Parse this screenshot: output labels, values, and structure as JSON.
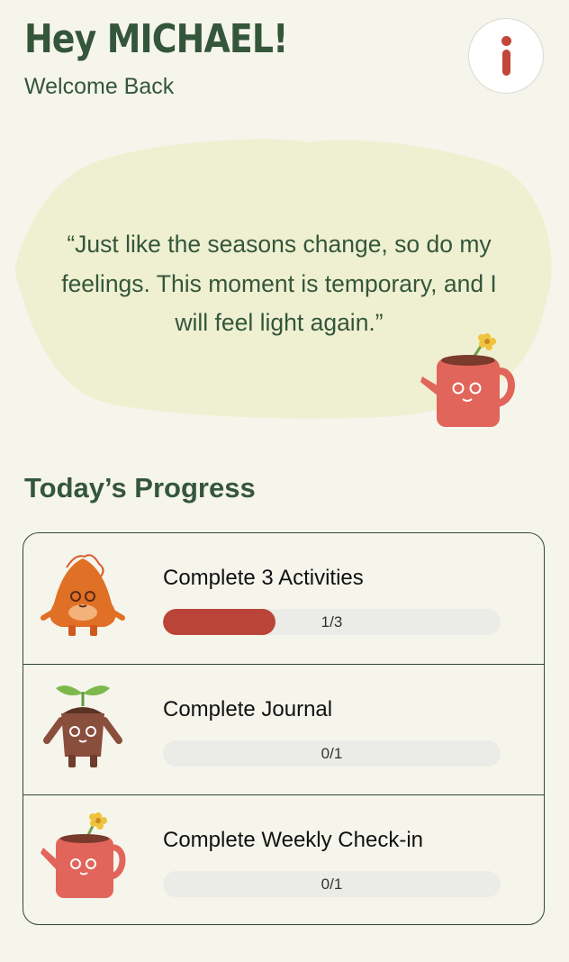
{
  "header": {
    "greeting": "Hey MICHAEL!",
    "subtitle": "Welcome Back",
    "info_icon": "info-icon"
  },
  "quote": {
    "text": "“Just like the seasons change, so do my feelings. This moment is temporary, and I will feel light again.”"
  },
  "progress": {
    "title": "Today’s Progress",
    "items": [
      {
        "label": "Complete 3 Activities",
        "count_text": "1/3",
        "completed": 1,
        "total": 3,
        "icon": "orange-flame-mascot-icon"
      },
      {
        "label": "Complete Journal",
        "count_text": "0/1",
        "completed": 0,
        "total": 1,
        "icon": "sprout-pot-mascot-icon"
      },
      {
        "label": "Complete Weekly Check-in",
        "count_text": "0/1",
        "completed": 0,
        "total": 1,
        "icon": "watering-can-mascot-icon"
      }
    ]
  },
  "colors": {
    "background": "#f6f5ec",
    "primary_text": "#34563a",
    "accent": "#bb4438",
    "quote_blob": "#eff0d2",
    "progress_track": "#ebebe7"
  }
}
